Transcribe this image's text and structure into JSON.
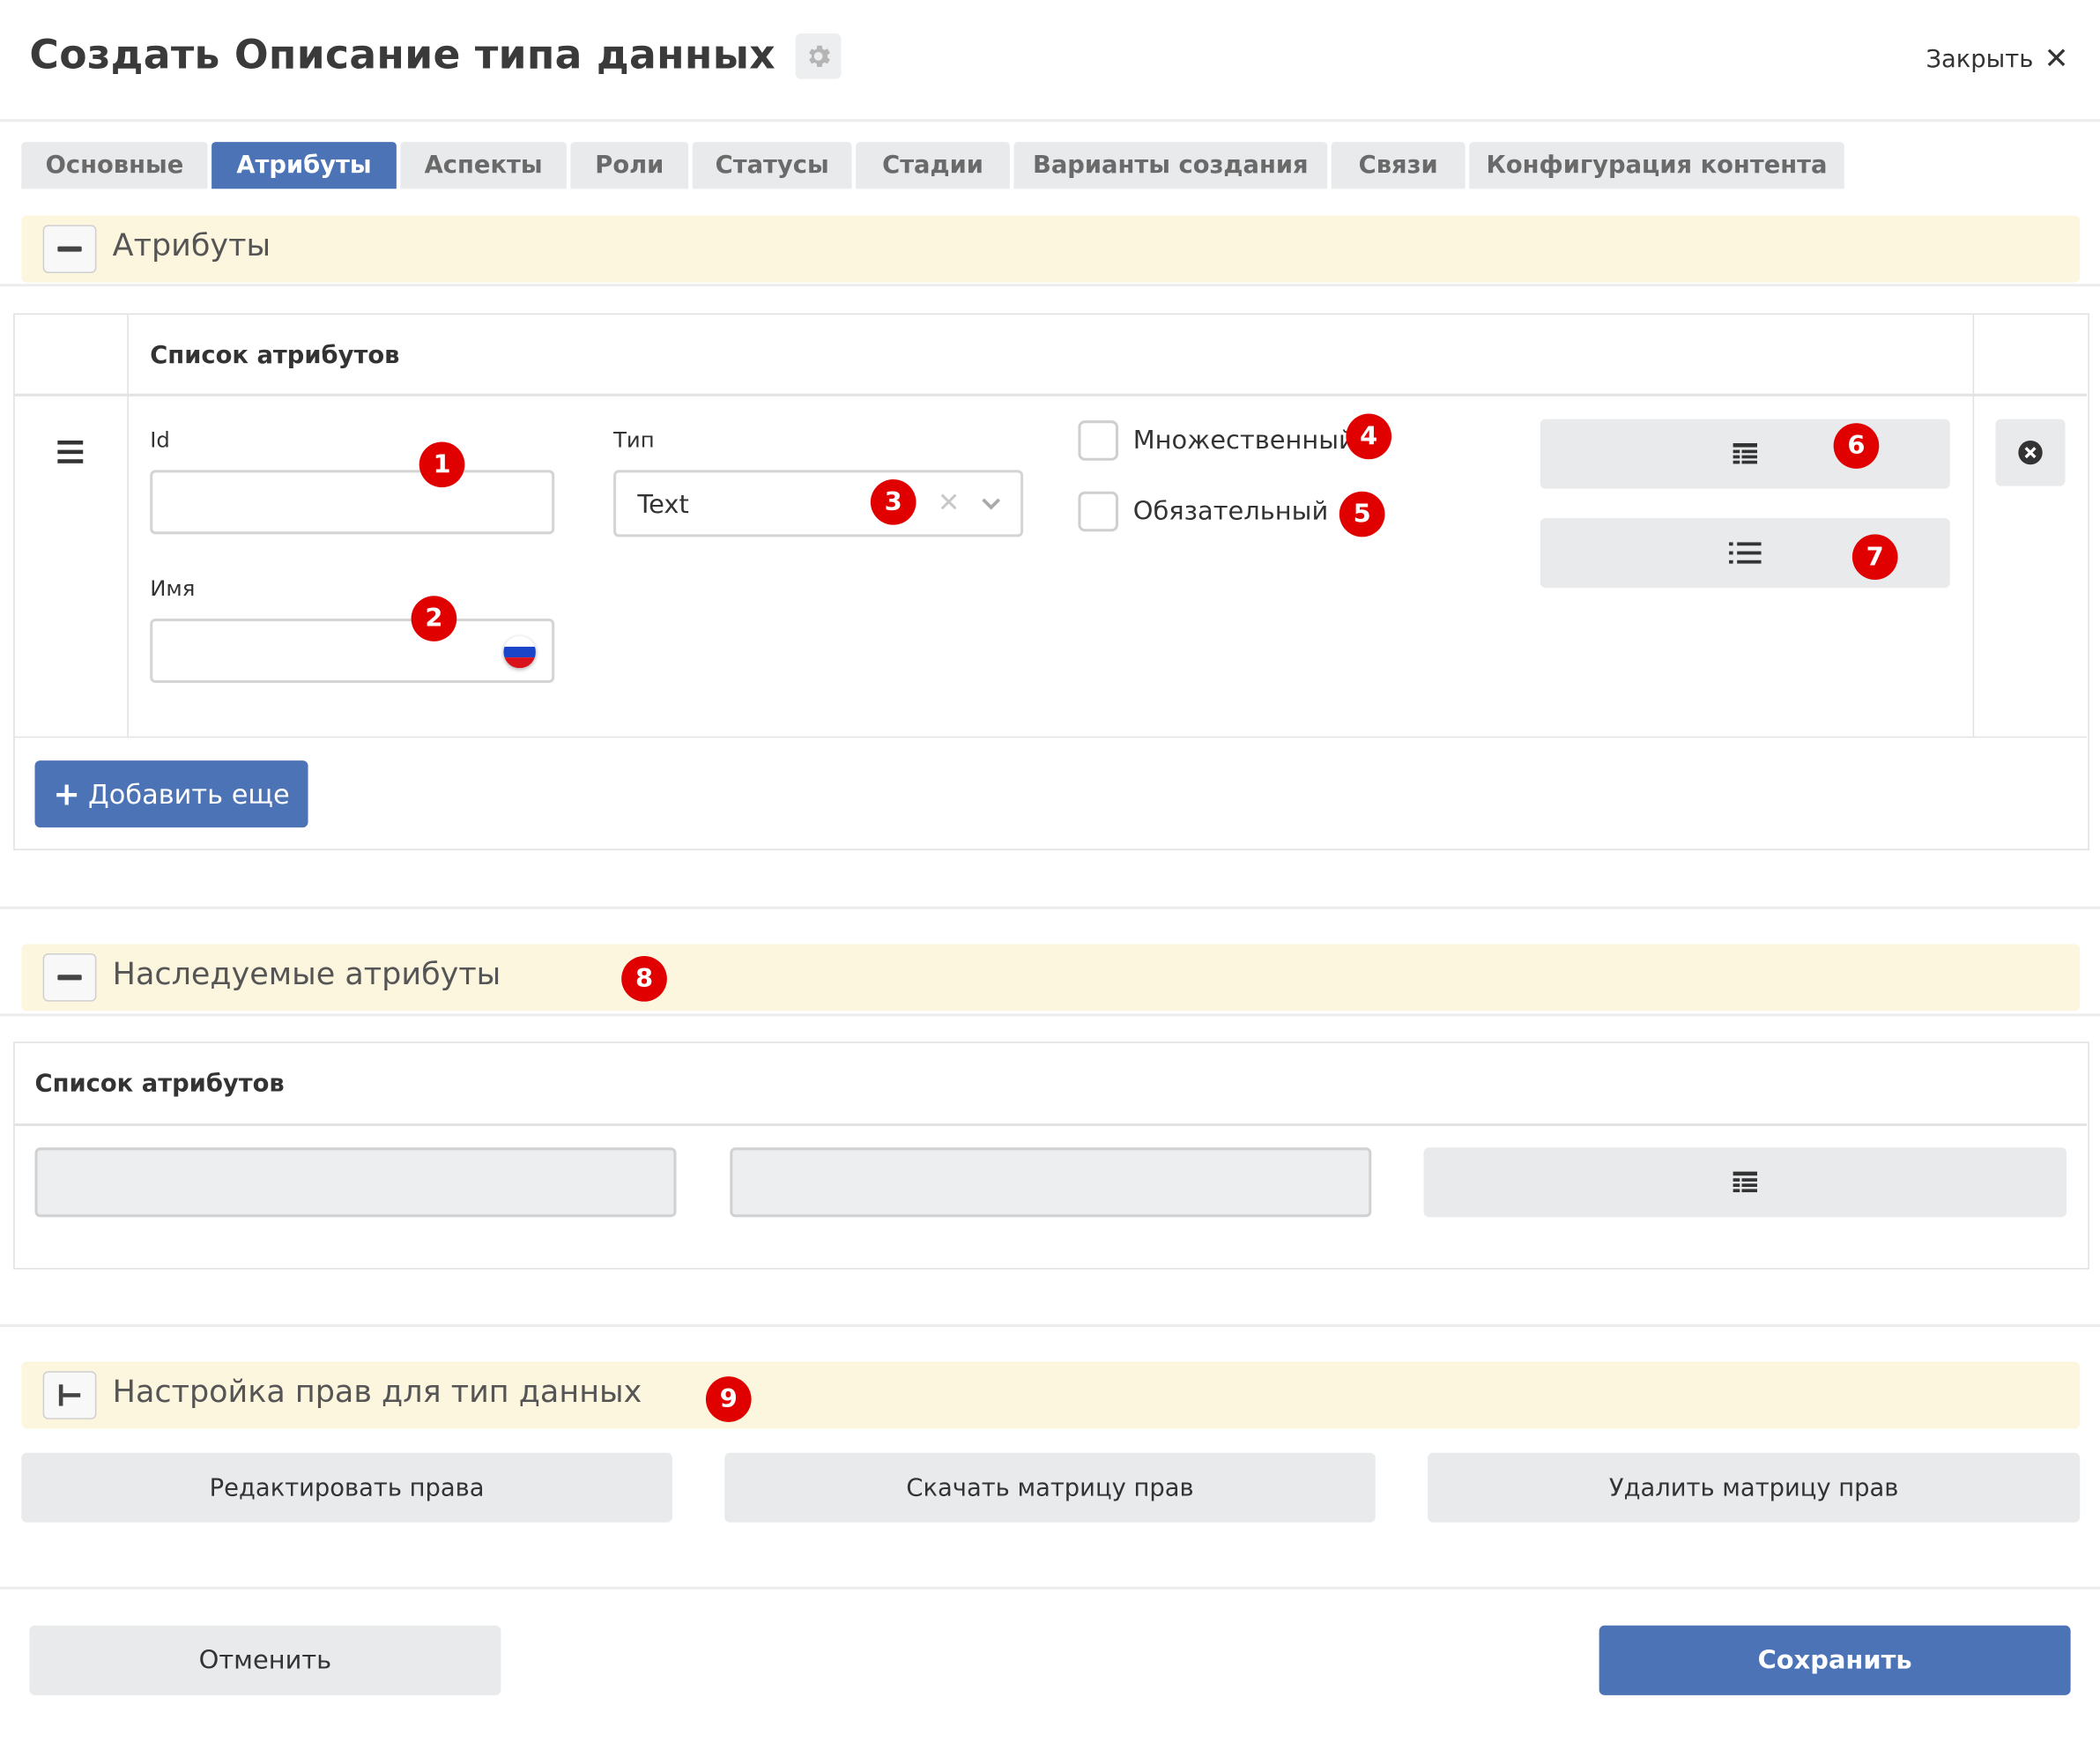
{
  "header": {
    "title": "Создать Описание типа данных",
    "close_label": "Закрыть"
  },
  "tabs": [
    {
      "label": "Основные"
    },
    {
      "label": "Атрибуты",
      "active": true
    },
    {
      "label": "Аспекты"
    },
    {
      "label": "Роли"
    },
    {
      "label": "Статусы"
    },
    {
      "label": "Стадии"
    },
    {
      "label": "Варианты создания"
    },
    {
      "label": "Связи"
    },
    {
      "label": "Конфигурация контента"
    }
  ],
  "attributes_panel": {
    "title": "Атрибуты",
    "list_header": "Список атрибутов",
    "row": {
      "id_label": "Id",
      "id_value": "",
      "name_label": "Имя",
      "name_value": "",
      "type_label": "Тип",
      "type_value": "Text",
      "multiple_label": "Множественный",
      "multiple_checked": false,
      "required_label": "Обязательный",
      "required_checked": false
    },
    "add_more_label": "Добавить еще"
  },
  "inherited_panel": {
    "title": "Наследуемые атрибуты",
    "list_header": "Список атрибутов"
  },
  "rights_panel": {
    "title": "Настройка прав для тип данных",
    "edit_rights": "Редактировать права",
    "download_matrix": "Скачать матрицу прав",
    "delete_matrix": "Удалить матрицу прав"
  },
  "footer": {
    "cancel": "Отменить",
    "save": "Сохранить"
  },
  "annotations": {
    "b1": "1",
    "b2": "2",
    "b3": "3",
    "b4": "4",
    "b5": "5",
    "b6": "6",
    "b7": "7",
    "b8": "8",
    "b9": "9"
  },
  "colors": {
    "primary": "#4b73b5",
    "panel_header": "#fdf6df",
    "badge": "#e10000"
  }
}
